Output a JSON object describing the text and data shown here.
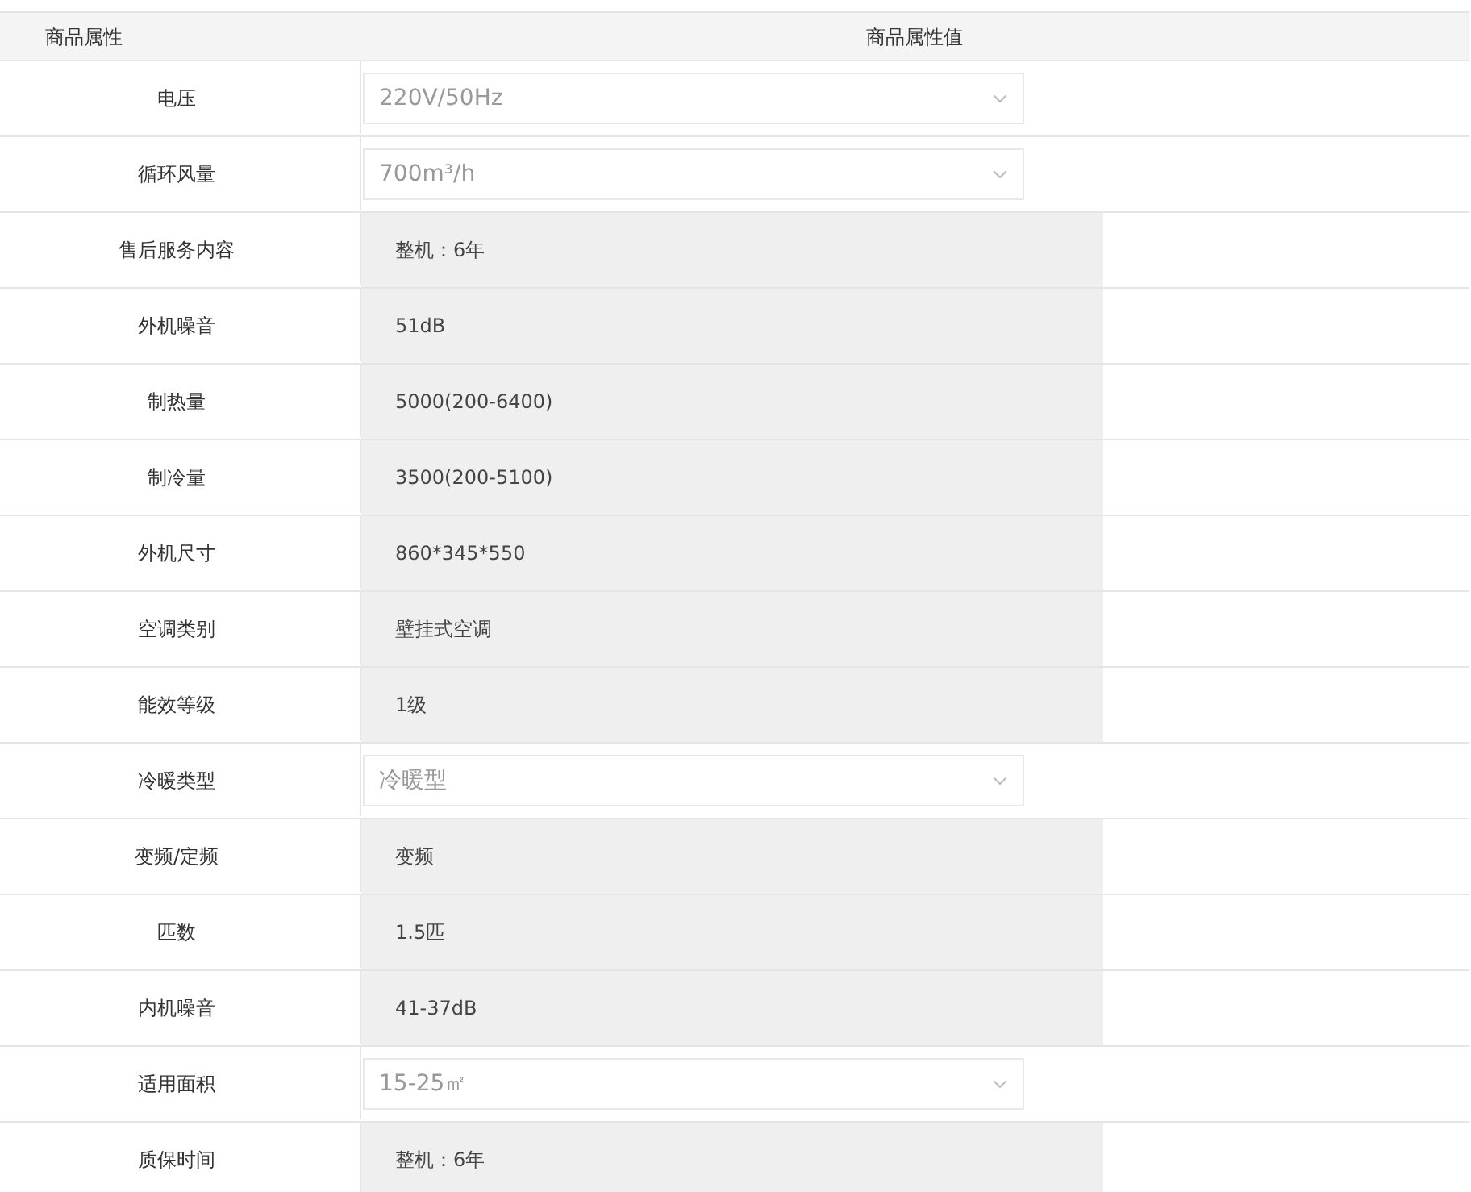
{
  "table": {
    "columns": [
      "商品属性",
      "商品属性值"
    ],
    "rows": [
      {
        "label": "电压",
        "kind": "select",
        "value": "220V/50Hz"
      },
      {
        "label": "循环风量",
        "kind": "select",
        "value": "700m³/h"
      },
      {
        "label": "售后服务内容",
        "kind": "text",
        "value": "整机：6年"
      },
      {
        "label": "外机噪音",
        "kind": "text",
        "value": "51dB"
      },
      {
        "label": "制热量",
        "kind": "text",
        "value": "5000(200-6400)"
      },
      {
        "label": "制冷量",
        "kind": "text",
        "value": "3500(200-5100)"
      },
      {
        "label": "外机尺寸",
        "kind": "text",
        "value": "860*345*550"
      },
      {
        "label": "空调类别",
        "kind": "text",
        "value": "壁挂式空调"
      },
      {
        "label": "能效等级",
        "kind": "text",
        "value": "1级"
      },
      {
        "label": "冷暖类型",
        "kind": "select",
        "value": "冷暖型"
      },
      {
        "label": "变频/定频",
        "kind": "text",
        "value": "变频"
      },
      {
        "label": "匹数",
        "kind": "text",
        "value": "1.5匹"
      },
      {
        "label": "内机噪音",
        "kind": "text",
        "value": "41-37dB"
      },
      {
        "label": "适用面积",
        "kind": "select",
        "value": "15-25㎡"
      },
      {
        "label": "质保时间",
        "kind": "text",
        "value": "整机：6年"
      }
    ]
  }
}
